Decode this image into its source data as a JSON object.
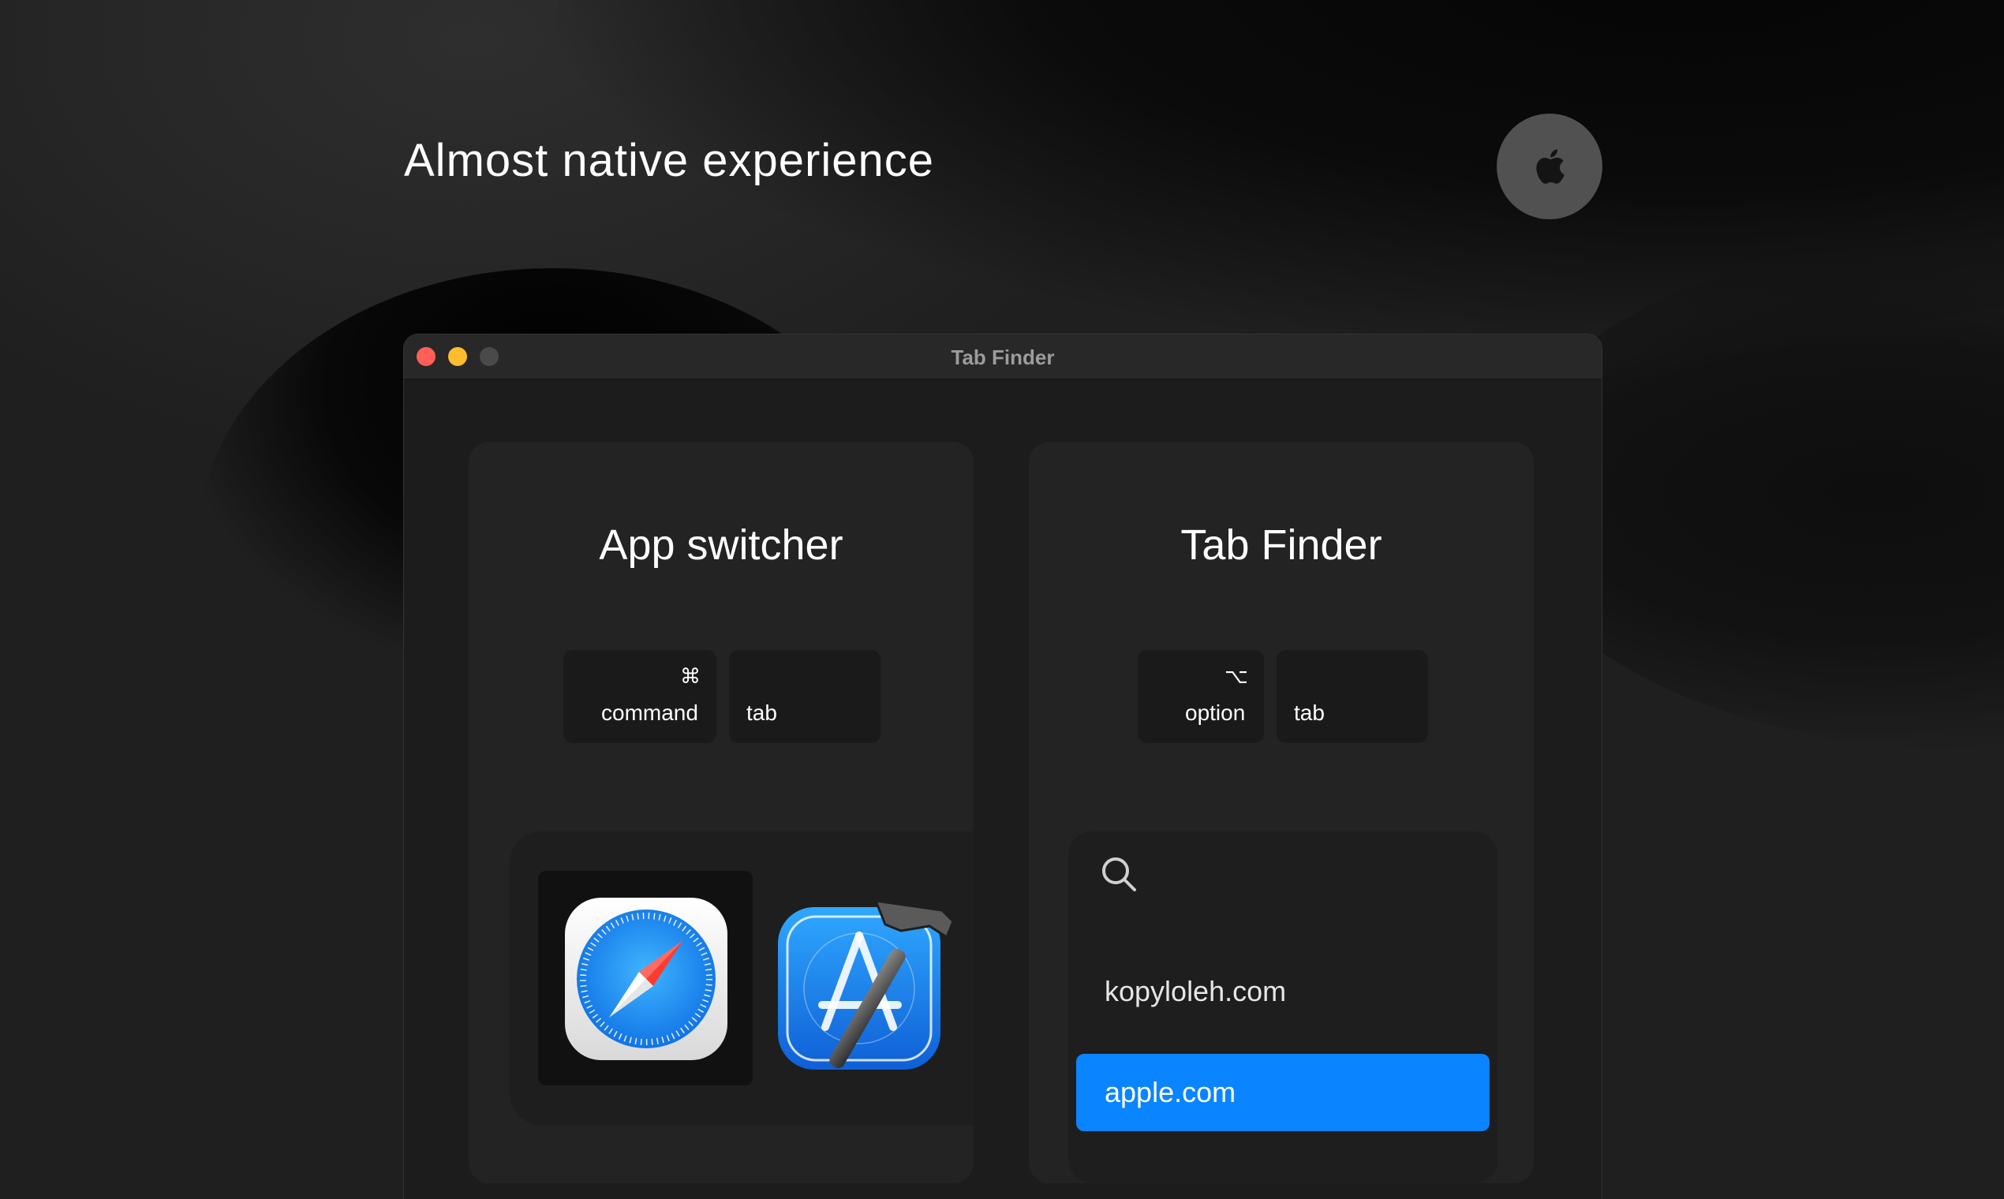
{
  "headline": "Almost native experience",
  "platform_icon": "apple-logo-icon",
  "window": {
    "title": "Tab Finder"
  },
  "app_switcher": {
    "title": "App switcher",
    "keys": [
      {
        "glyph": "⌘",
        "label": "command"
      },
      {
        "glyph": "",
        "label": "tab"
      }
    ],
    "apps": [
      {
        "name": "safari-icon",
        "selected": true
      },
      {
        "name": "xcode-icon",
        "selected": false
      }
    ]
  },
  "tab_finder": {
    "title": "Tab Finder",
    "keys": [
      {
        "glyph": "⌥",
        "label": "option"
      },
      {
        "glyph": "",
        "label": "tab"
      }
    ],
    "search_placeholder": "",
    "results": [
      {
        "label": "kopyloleh.com",
        "selected": false
      },
      {
        "label": "apple.com",
        "selected": true
      }
    ]
  },
  "colors": {
    "accent": "#0a84ff",
    "close": "#ff5f57",
    "minimize": "#febc2e",
    "maximize_disabled": "#4a4a4a"
  }
}
